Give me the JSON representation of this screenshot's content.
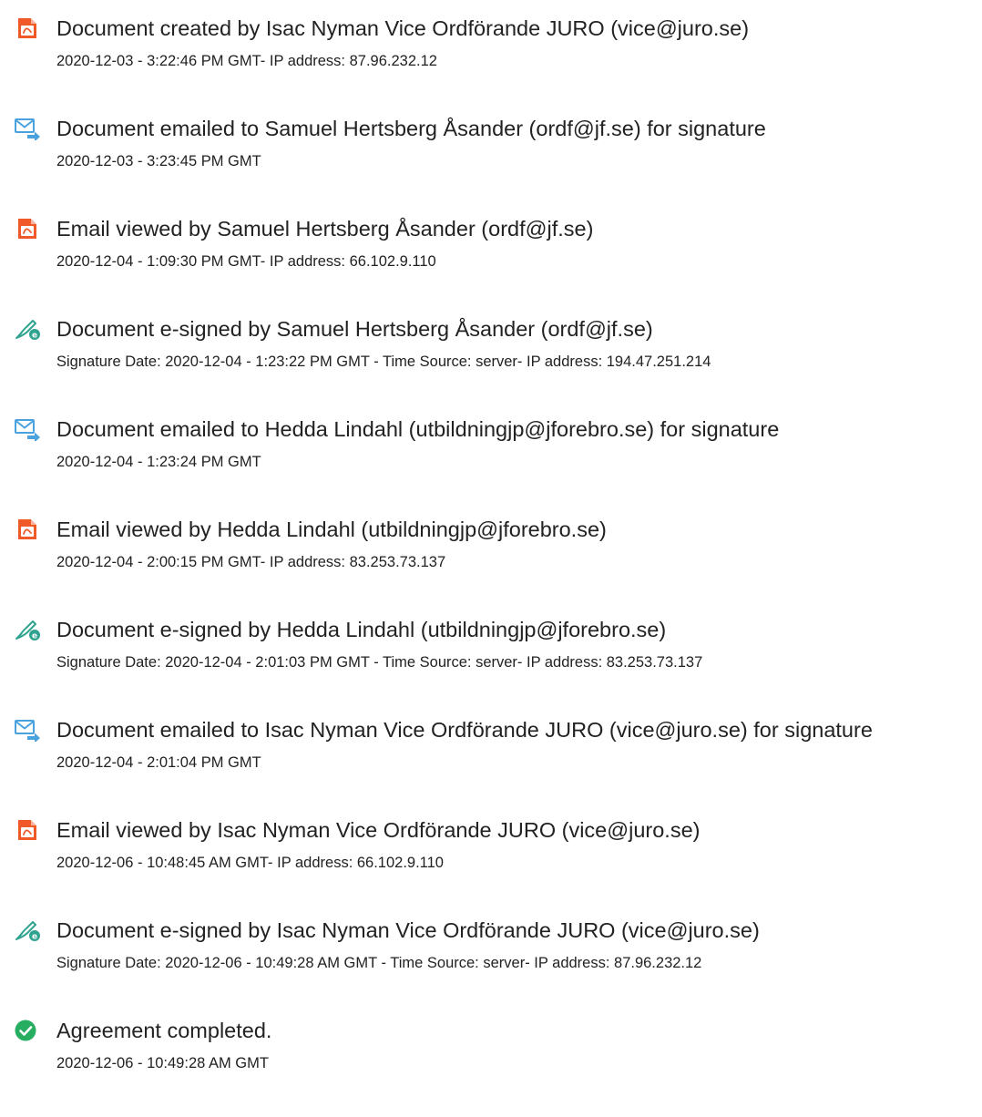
{
  "events": [
    {
      "icon": "acrobat-document-icon",
      "title": "Document created by Isac Nyman Vice Ordförande JURO (vice@juro.se)",
      "detail": "2020-12-03 - 3:22:46 PM GMT- IP address: 87.96.232.12"
    },
    {
      "icon": "email-sent-icon",
      "title": "Document emailed to Samuel Hertsberg Åsander (ordf@jf.se) for signature",
      "detail": "2020-12-03 - 3:23:45 PM GMT"
    },
    {
      "icon": "acrobat-document-icon",
      "title": "Email viewed by Samuel Hertsberg Åsander (ordf@jf.se)",
      "detail": "2020-12-04 - 1:09:30 PM GMT- IP address: 66.102.9.110"
    },
    {
      "icon": "e-sign-pen-icon",
      "title": "Document e-signed by Samuel Hertsberg Åsander (ordf@jf.se)",
      "detail": "Signature Date: 2020-12-04 - 1:23:22 PM GMT - Time Source: server- IP address: 194.47.251.214"
    },
    {
      "icon": "email-sent-icon",
      "title": "Document emailed to Hedda Lindahl (utbildningjp@jforebro.se) for signature",
      "detail": "2020-12-04 - 1:23:24 PM GMT"
    },
    {
      "icon": "acrobat-document-icon",
      "title": "Email viewed by Hedda Lindahl (utbildningjp@jforebro.se)",
      "detail": "2020-12-04 - 2:00:15 PM GMT- IP address: 83.253.73.137"
    },
    {
      "icon": "e-sign-pen-icon",
      "title": "Document e-signed by Hedda Lindahl (utbildningjp@jforebro.se)",
      "detail": "Signature Date: 2020-12-04 - 2:01:03 PM GMT - Time Source: server- IP address: 83.253.73.137"
    },
    {
      "icon": "email-sent-icon",
      "title": "Document emailed to Isac Nyman Vice Ordförande JURO (vice@juro.se) for signature",
      "detail": "2020-12-04 - 2:01:04 PM GMT"
    },
    {
      "icon": "acrobat-document-icon",
      "title": "Email viewed by Isac Nyman Vice Ordförande JURO (vice@juro.se)",
      "detail": "2020-12-06 - 10:48:45 AM GMT- IP address: 66.102.9.110"
    },
    {
      "icon": "e-sign-pen-icon",
      "title": "Document e-signed by Isac Nyman Vice Ordförande JURO (vice@juro.se)",
      "detail": "Signature Date: 2020-12-06 - 10:49:28 AM GMT - Time Source: server- IP address: 87.96.232.12"
    },
    {
      "icon": "check-circle-icon",
      "title": "Agreement completed.",
      "detail": "2020-12-06 - 10:49:28 AM GMT"
    }
  ],
  "colors": {
    "acrobat_orange": "#f05a28",
    "email_blue": "#4aa3df",
    "sign_green": "#2fa38f",
    "check_green": "#27ae60",
    "text": "#222222"
  }
}
